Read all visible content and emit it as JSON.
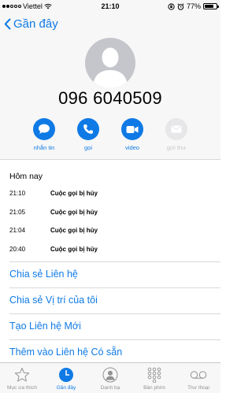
{
  "status_bar": {
    "carrier": "Viettel",
    "time": "21:10",
    "battery_percent": "77%",
    "battery_level": 0.77,
    "signal_full_dots": 2,
    "signal_total_dots": 5
  },
  "nav": {
    "back_label": "Gần đây"
  },
  "contact": {
    "phone_number": "096 6040509"
  },
  "actions": [
    {
      "label": "nhắn tin",
      "icon": "message-icon",
      "enabled": true
    },
    {
      "label": "gọi",
      "icon": "phone-icon",
      "enabled": true
    },
    {
      "label": "video",
      "icon": "video-icon",
      "enabled": true
    },
    {
      "label": "gửi thư",
      "icon": "mail-icon",
      "enabled": false
    }
  ],
  "recents": {
    "title": "Hôm nay",
    "items": [
      {
        "time": "21:10",
        "status": "Cuộc gọi bị hủy"
      },
      {
        "time": "21:05",
        "status": "Cuộc gọi bị hủy"
      },
      {
        "time": "21:04",
        "status": "Cuộc gọi bị hủy"
      },
      {
        "time": "20:40",
        "status": "Cuộc gọi bị hủy"
      }
    ]
  },
  "links": {
    "share_contact": "Chia sẻ Liên hệ",
    "share_location": "Chia sẻ Vị trí của tôi",
    "create_contact": "Tạo Liên hệ Mới",
    "add_to_existing": "Thêm vào Liên hệ Có sẵn"
  },
  "tabs": [
    {
      "label": "Mục ưa thích",
      "icon": "star-icon",
      "active": false
    },
    {
      "label": "Gần đây",
      "icon": "clock-icon",
      "active": true
    },
    {
      "label": "Danh bạ",
      "icon": "contacts-icon",
      "active": false
    },
    {
      "label": "Bàn phím",
      "icon": "keypad-icon",
      "active": false
    },
    {
      "label": "Thư thoại",
      "icon": "voicemail-icon",
      "active": false
    }
  ],
  "colors": {
    "accent": "#0f7ae5",
    "inactive": "#929292",
    "header_bg": "#f7f7f7"
  }
}
